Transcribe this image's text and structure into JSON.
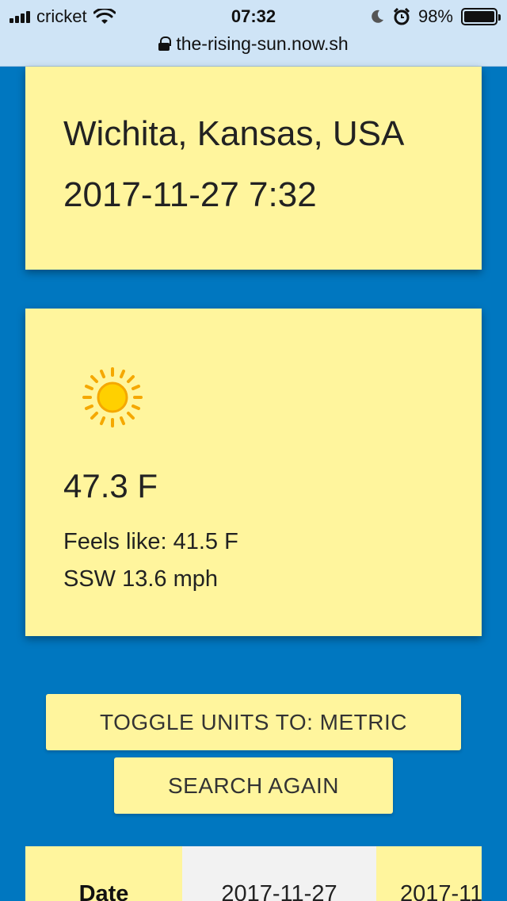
{
  "status_bar": {
    "carrier": "cricket",
    "time": "07:32",
    "battery_percent": "98%"
  },
  "url_bar": {
    "url": "the-rising-sun.now.sh"
  },
  "location_card": {
    "location": "Wichita, Kansas, USA",
    "datetime": "2017-11-27 7:32"
  },
  "weather_card": {
    "icon": "sun-icon",
    "temperature": "47.3 F",
    "feels_like": "Feels like: 41.5 F",
    "wind": "SSW 13.6 mph"
  },
  "buttons": {
    "toggle_units": "TOGGLE UNITS TO: METRIC",
    "search_again": "SEARCH AGAIN"
  },
  "forecast_table": {
    "header_label": "Date",
    "dates": [
      "2017-11-27",
      "2017-11"
    ]
  },
  "colors": {
    "background": "#0077c0",
    "card": "#fff59d",
    "topbar": "#cfe4f6"
  }
}
